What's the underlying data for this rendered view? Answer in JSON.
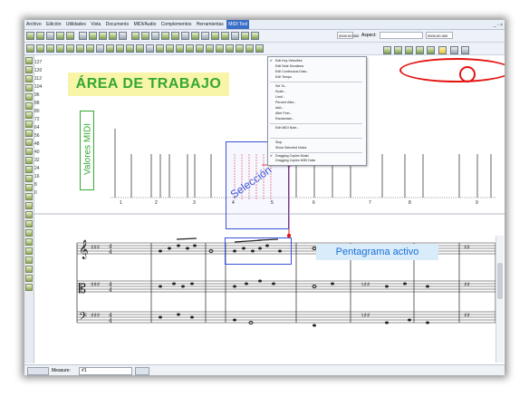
{
  "menubar": {
    "items": [
      "Archivo",
      "Edición",
      "Utilidades",
      "Vista",
      "Documento",
      "MIDI/Audio",
      "Complementos",
      "Herramientas",
      "MIDI Tool"
    ],
    "active_index": 8,
    "window_buttons": "_ ▫ ×"
  },
  "toolbar": {
    "aspect_label": "Aspect:",
    "time_value": "0000:00.000"
  },
  "dropdown": {
    "items": [
      {
        "label": "Edit Key Velocities",
        "check": true,
        "group": 1
      },
      {
        "label": "Edit Note Durations",
        "check": false,
        "group": 1
      },
      {
        "label": "Edit Continuous Data...",
        "check": false,
        "group": 1
      },
      {
        "label": "Edit Tempo",
        "check": false,
        "group": 1
      },
      {
        "label": "Set To...",
        "check": false,
        "group": 2
      },
      {
        "label": "Scale...",
        "check": false,
        "group": 2
      },
      {
        "label": "Limit...",
        "check": false,
        "group": 2
      },
      {
        "label": "Percent Alter...",
        "check": false,
        "group": 2
      },
      {
        "label": "Add...",
        "check": false,
        "group": 2
      },
      {
        "label": "Alter Feel...",
        "check": false,
        "group": 2
      },
      {
        "label": "Randomize...",
        "check": false,
        "group": 2
      },
      {
        "label": "Edit MIDI Note...",
        "check": false,
        "group": 3
      },
      {
        "label": "Stop",
        "check": false,
        "group": 4
      },
      {
        "label": "Show Selected Notes",
        "check": false,
        "group": 4
      },
      {
        "label": "Dragging Copies Music",
        "check": true,
        "group": 5
      },
      {
        "label": "Dragging Copies MIDI Data",
        "check": false,
        "group": 5
      }
    ]
  },
  "vertical_axis": {
    "labels": [
      "127",
      "120",
      "112",
      "104",
      "96",
      "88",
      "80",
      "72",
      "64",
      "56",
      "48",
      "40",
      "32",
      "24",
      "16",
      "8",
      "0"
    ]
  },
  "measure_numbers": [
    "1",
    "2",
    "3",
    "4",
    "5",
    "6",
    "7",
    "8",
    "9"
  ],
  "annotations": {
    "work_area": "ÁREA DE TRABAJO",
    "midi_values": "Valores MIDI",
    "selection": "Selección",
    "active_staff": "Pentagrama activo"
  },
  "statusbar": {
    "measure_label": "Measure:",
    "measure_value": "#1"
  },
  "colors": {
    "green_label": "#34a832",
    "highlight_yellow": "#f8f4a8",
    "selection_blue": "#3a52d8",
    "annotation_red": "#e41414",
    "staff_label_bg": "#d8ecfa"
  }
}
